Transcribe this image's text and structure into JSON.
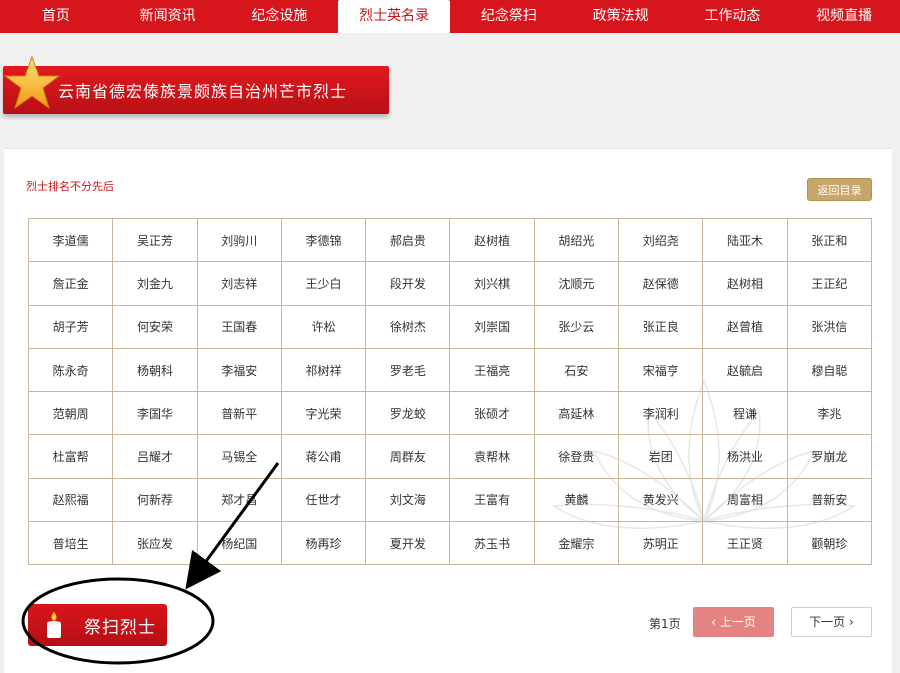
{
  "nav": {
    "items": [
      "首页",
      "新闻资讯",
      "纪念设施",
      "烈士英名录",
      "纪念祭扫",
      "政策法规",
      "工作动态",
      "视频直播"
    ],
    "active_index": 3
  },
  "banner": {
    "title": "云南省德宏傣族景颇族自治州芒市烈士"
  },
  "panel": {
    "note": "烈士排名不分先后",
    "back_button": "返回目录"
  },
  "names": [
    [
      "李道儒",
      "吴正芳",
      "刘驹川",
      "李德锦",
      "郝启贵",
      "赵树植",
      "胡绍光",
      "刘绍尧",
      "陆亚木",
      "张正和"
    ],
    [
      "詹正金",
      "刘金九",
      "刘志祥",
      "王少白",
      "段开发",
      "刘兴棋",
      "沈顺元",
      "赵保德",
      "赵树相",
      "王正纪"
    ],
    [
      "胡子芳",
      "何安荣",
      "王国春",
      "许松",
      "徐树杰",
      "刘崇国",
      "张少云",
      "张正良",
      "赵曾植",
      "张洪信"
    ],
    [
      "陈永奇",
      "杨朝科",
      "李福安",
      "祁树祥",
      "罗老毛",
      "王福亮",
      "石安",
      "宋福亨",
      "赵毓启",
      "穆自聪"
    ],
    [
      "范朝周",
      "李国华",
      "普新平",
      "字光荣",
      "罗龙蛟",
      "张硕才",
      "高延林",
      "李润利",
      "程谦",
      "李兆"
    ],
    [
      "杜富帮",
      "吕耀才",
      "马锡全",
      "蒋公甫",
      "周群友",
      "袁帮林",
      "徐登贵",
      "岩团",
      "杨洪业",
      "罗崩龙"
    ],
    [
      "赵熙福",
      "何新荐",
      "郑才昌",
      "任世才",
      "刘文海",
      "王富有",
      "黄麟",
      "黄发兴",
      "周富相",
      "普新安"
    ],
    [
      "普培生",
      "张应发",
      "杨纪国",
      "杨再珍",
      "夏开发",
      "苏玉书",
      "金耀宗",
      "苏明正",
      "王正贤",
      "颧朝珍"
    ]
  ],
  "sweep_button": {
    "label": "祭扫烈士"
  },
  "pagination": {
    "page_info": "第1页",
    "prev_label": "上一页",
    "next_label": "下一页"
  },
  "colors": {
    "brand_red": "#d7151c",
    "gold": "#c6a66a",
    "prev_bg": "#e58282"
  },
  "icons": [
    "star-icon",
    "candle-icon",
    "chevron-left-icon",
    "chevron-right-icon"
  ]
}
